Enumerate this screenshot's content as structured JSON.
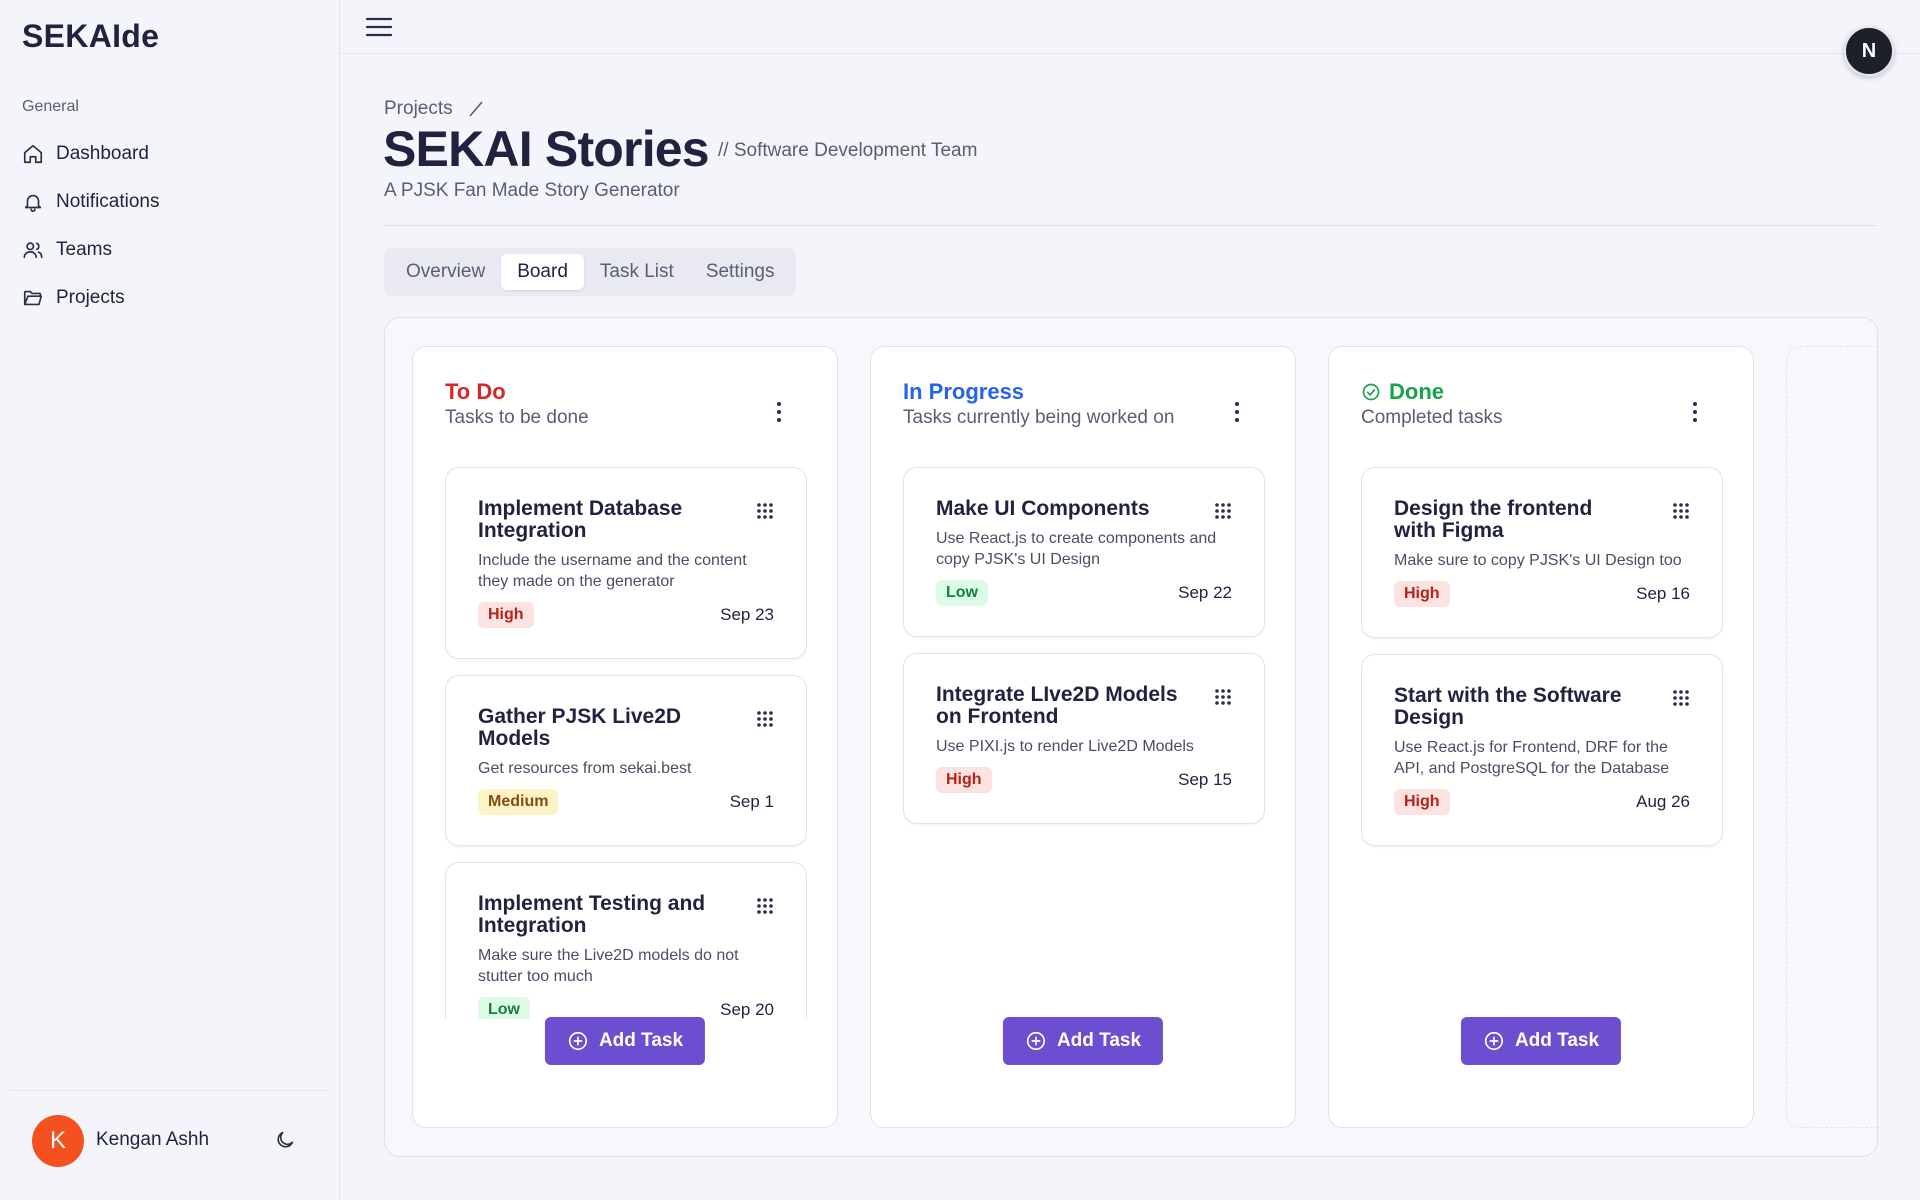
{
  "app": {
    "logo": "SEKAIde"
  },
  "sidebar": {
    "group_label": "General",
    "items": [
      {
        "label": "Dashboard",
        "icon": "home-icon"
      },
      {
        "label": "Notifications",
        "icon": "bell-icon"
      },
      {
        "label": "Teams",
        "icon": "users-icon"
      },
      {
        "label": "Projects",
        "icon": "folder-icon"
      }
    ],
    "user": {
      "initial": "K",
      "name": "Kengan Ashh",
      "avatar_color": "#f4511e"
    }
  },
  "topbar": {
    "user_initial": "N"
  },
  "header": {
    "breadcrumb": "Projects",
    "title": "SEKAI Stories",
    "team": "// Software Development Team",
    "description": "A PJSK Fan Made Story Generator"
  },
  "tabs": [
    {
      "label": "Overview",
      "active": false
    },
    {
      "label": "Board",
      "active": true
    },
    {
      "label": "Task List",
      "active": false
    },
    {
      "label": "Settings",
      "active": false
    }
  ],
  "columns": [
    {
      "title": "To Do",
      "subtitle": "Tasks to be done",
      "color": "#dc2626",
      "add_label": "Add Task",
      "cards": [
        {
          "title": "Implement Database Integration",
          "description": "Include the username and the content they made on the generator",
          "priority": "High",
          "date": "Sep 23"
        },
        {
          "title": "Gather PJSK Live2D Models",
          "description": "Get resources from sekai.best",
          "priority": "Medium",
          "date": "Sep 1"
        },
        {
          "title": "Implement Testing and Integration",
          "description": "Make sure the Live2D models do not stutter too much",
          "priority": "Low",
          "date": "Sep 20"
        }
      ]
    },
    {
      "title": "In Progress",
      "subtitle": "Tasks currently being worked on",
      "color": "#2563eb",
      "add_label": "Add Task",
      "cards": [
        {
          "title": "Make UI Components",
          "description": "Use React.js to create components and copy PJSK's UI Design",
          "priority": "Low",
          "date": "Sep 22"
        },
        {
          "title": "Integrate LIve2D Models on Frontend",
          "description": "Use PIXI.js to render Live2D Models",
          "priority": "High",
          "date": "Sep 15"
        }
      ]
    },
    {
      "title": "Done",
      "subtitle": "Completed tasks",
      "color": "#16a34a",
      "add_label": "Add Task",
      "cards": [
        {
          "title": "Design the frontend with Figma",
          "description": "Make sure to copy PJSK's UI Design too",
          "priority": "High",
          "date": "Sep 16"
        },
        {
          "title": "Start with the Software Design",
          "description": "Use React.js for Frontend, DRF for the API, and PostgreSQL for the Database",
          "priority": "High",
          "date": "Aug 26"
        }
      ]
    }
  ],
  "colors": {
    "accent": "#6b4fd0",
    "background": "#f4f4fb"
  }
}
